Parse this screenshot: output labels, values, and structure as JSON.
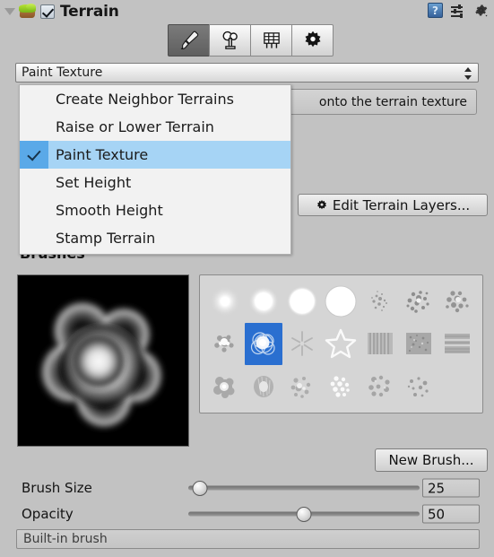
{
  "header": {
    "title": "Terrain",
    "foldout_icon": "triangle-down-icon",
    "component_icon": "terrain-icon",
    "enabled_checkbox": true,
    "help_icon_label": "?",
    "icons": [
      "help-icon",
      "preset-icon",
      "gear-icon"
    ]
  },
  "toolbar": {
    "tabs": [
      {
        "name": "paint-terrain",
        "icon": "paintbrush-icon",
        "active": true
      },
      {
        "name": "paint-trees",
        "icon": "tree-icon",
        "active": false
      },
      {
        "name": "paint-details",
        "icon": "grass-details-icon",
        "active": false
      },
      {
        "name": "terrain-settings",
        "icon": "gear-icon",
        "active": false
      }
    ]
  },
  "mode": {
    "selected": "Paint Texture",
    "options": [
      "Create Neighbor Terrains",
      "Raise or Lower Terrain",
      "Paint Texture",
      "Set Height",
      "Smooth Height",
      "Stamp Terrain"
    ],
    "checked_index": 2
  },
  "help": {
    "text": "onto the terrain texture"
  },
  "layers": {
    "edit_button": "Edit Terrain Layers...",
    "edit_button_icon": "gear-icon"
  },
  "brushes": {
    "section_label": "Brushes",
    "preview_name": "brush-preview",
    "selected_index": 8,
    "count": 20,
    "new_brush_button": "New Brush...",
    "name_field_value": "Built-in brush"
  },
  "sliders": [
    {
      "label": "Brush Size",
      "value": "25",
      "percent": 5
    },
    {
      "label": "Opacity",
      "value": "50",
      "percent": 50
    }
  ],
  "colors": {
    "panel_bg": "#c2c2c2",
    "popup_bg": "#f2f2f2",
    "popup_highlight": "#a6d4f5",
    "popup_check_col": "#5aa9e8",
    "brush_selection": "#2a6fd0",
    "text": "#141414"
  }
}
